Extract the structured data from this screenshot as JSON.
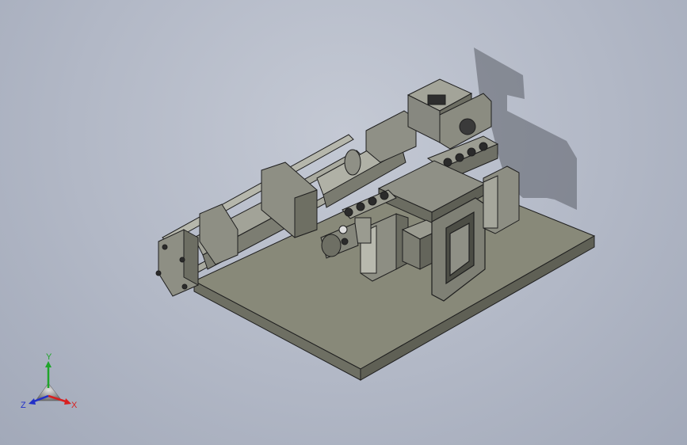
{
  "viewport": {
    "background_top": "#c4c9d4",
    "background_bottom": "#a2a9b9"
  },
  "model": {
    "plate_color": "#86867a",
    "part_color": "#8f9086",
    "edge_color": "#1f1f1f",
    "shadow_color": "#5b5f67"
  },
  "triad": {
    "x_label": "X",
    "y_label": "Y",
    "z_label": "Z",
    "x_color": "#d82020",
    "y_color": "#1fa52a",
    "z_color": "#2230c8"
  }
}
